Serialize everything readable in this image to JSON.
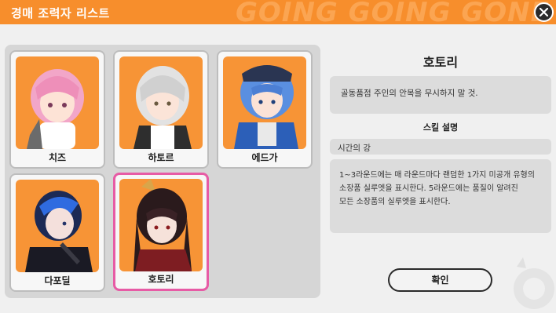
{
  "header": {
    "title": "경매 조력자 리스트",
    "bg_text": "GOING GOING GONE",
    "color": "#f78e2c"
  },
  "close_icon": "close-icon",
  "helpers": [
    {
      "name": "치즈",
      "hair": "#f2a6c8",
      "selected": false
    },
    {
      "name": "하토르",
      "hair": "#e2e2e2",
      "selected": false
    },
    {
      "name": "에드가",
      "hair": "#5a8fe0",
      "selected": false
    },
    {
      "name": "다포딜",
      "hair": "#1c2a55",
      "selected": false
    },
    {
      "name": "호토리",
      "hair": "#2a1a1c",
      "selected": true
    }
  ],
  "selected_color": "#e75ba5",
  "detail": {
    "name": "호토리",
    "description": "골동품점 주인의 안목을 무시하지 말 것.",
    "skill_heading": "스킬 설명",
    "skill_name": "시간의 강",
    "skill_desc_lines": [
      "1~3라운드에는 매 라운드마다 랜덤한 1가지 미공개 유형의",
      "소장품 실루엣을 표시한다. 5라운드에는 품질이 알려진",
      "모든 소장품의 실루엣을 표시한다."
    ]
  },
  "confirm_label": "확인"
}
